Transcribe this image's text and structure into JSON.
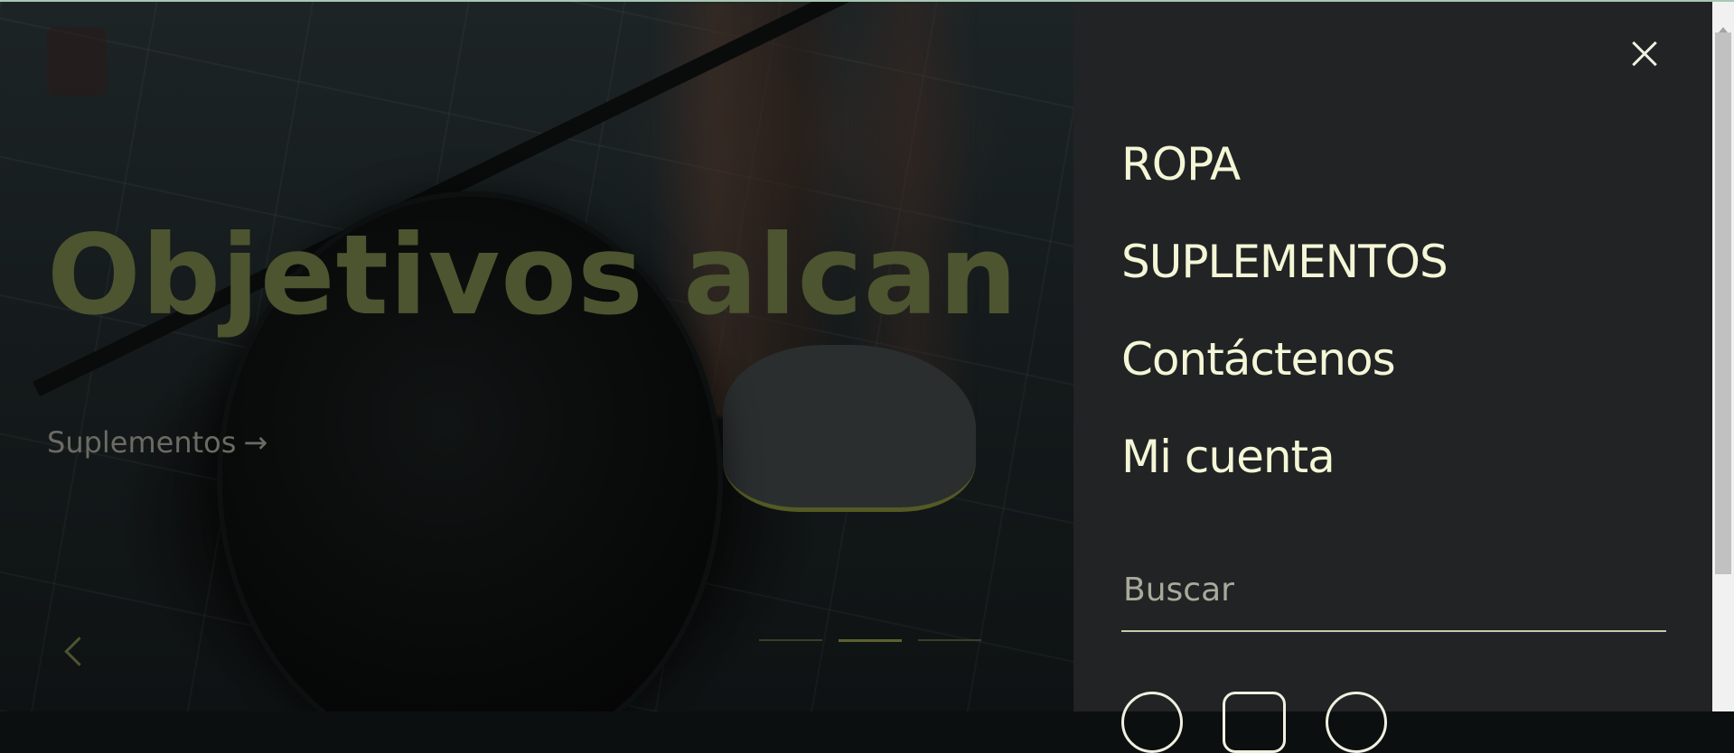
{
  "hero": {
    "headline": "Objetivos alcan",
    "link_label": "Suplementos",
    "link_arrow": "→",
    "prev_icon": "chevron-left-icon",
    "slides": [
      {
        "active": false
      },
      {
        "active": true
      },
      {
        "active": false
      }
    ]
  },
  "menu": {
    "close_icon": "close-icon",
    "items": [
      {
        "label": "ROPA"
      },
      {
        "label": "SUPLEMENTOS"
      },
      {
        "label": "Contáctenos"
      },
      {
        "label": "Mi cuenta"
      }
    ],
    "search": {
      "placeholder": "Buscar",
      "value": ""
    },
    "social_icons": [
      "facebook-icon",
      "instagram-icon",
      "pinterest-icon"
    ]
  },
  "colors": {
    "panel_bg": "#212325",
    "menu_text": "#f4f6d6",
    "headline_olive": "#4d5430"
  }
}
